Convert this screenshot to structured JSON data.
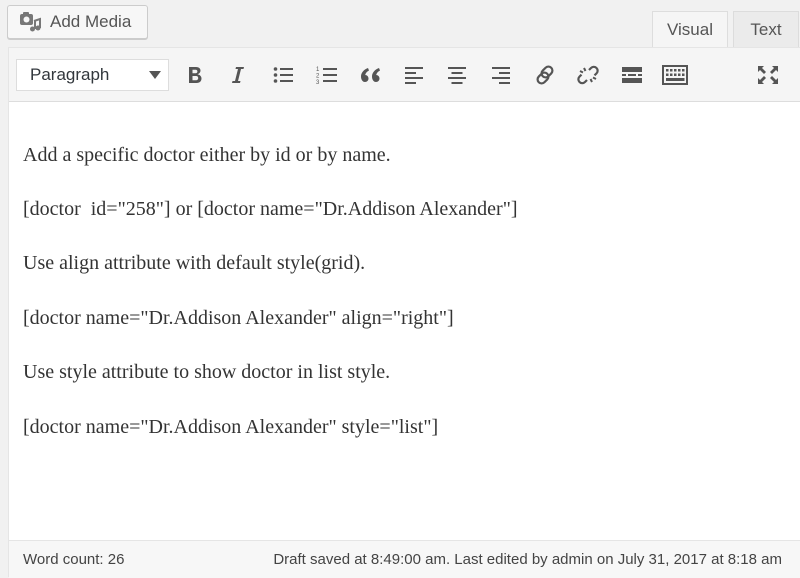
{
  "media": {
    "add_media_label": "Add Media"
  },
  "tabs": {
    "visual": "Visual",
    "text": "Text"
  },
  "toolbar": {
    "format_value": "Paragraph",
    "numbered_list_digits": [
      "1",
      "2",
      "3"
    ]
  },
  "content": {
    "paragraphs": [
      "Add a specific doctor either by id or by name.",
      "[doctor  id=\"258\"] or [doctor name=\"Dr.Addison Alexander\"]",
      "Use align attribute with default style(grid).",
      "[doctor name=\"Dr.Addison Alexander\" align=\"right\"]",
      "Use style attribute to show doctor in list style.",
      "[doctor name=\"Dr.Addison Alexander\" style=\"list\"]"
    ]
  },
  "status": {
    "word_count": "Word count: 26",
    "draft_saved": "Draft saved at 8:49:00 am. Last edited by admin on July 31, 2017 at 8:18 am"
  },
  "icons": {
    "add_media": "media-camera-music-icon",
    "bold": "bold-icon",
    "italic": "italic-icon",
    "bullet_list": "bulleted-list-icon",
    "numbered_list": "numbered-list-icon",
    "blockquote": "blockquote-icon",
    "align_left": "align-left-icon",
    "align_center": "align-center-icon",
    "align_right": "align-right-icon",
    "link": "link-icon",
    "unlink": "unlink-icon",
    "read_more": "read-more-icon",
    "toolbar_toggle": "keyboard-toolbar-toggle-icon",
    "fullscreen": "fullscreen-icon"
  }
}
